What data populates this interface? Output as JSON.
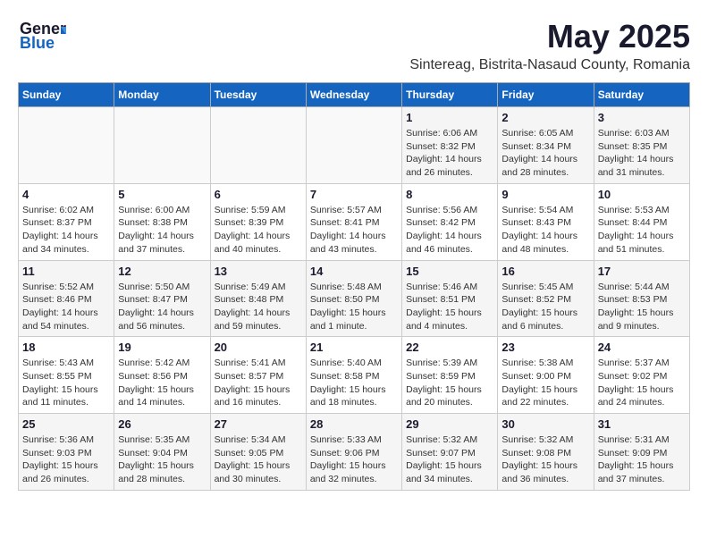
{
  "header": {
    "logo_general": "General",
    "logo_blue": "Blue",
    "title": "May 2025",
    "subtitle": "Sintereag, Bistrita-Nasaud County, Romania"
  },
  "weekdays": [
    "Sunday",
    "Monday",
    "Tuesday",
    "Wednesday",
    "Thursday",
    "Friday",
    "Saturday"
  ],
  "weeks": [
    [
      {
        "day": "",
        "info": ""
      },
      {
        "day": "",
        "info": ""
      },
      {
        "day": "",
        "info": ""
      },
      {
        "day": "",
        "info": ""
      },
      {
        "day": "1",
        "info": "Sunrise: 6:06 AM\nSunset: 8:32 PM\nDaylight: 14 hours\nand 26 minutes."
      },
      {
        "day": "2",
        "info": "Sunrise: 6:05 AM\nSunset: 8:34 PM\nDaylight: 14 hours\nand 28 minutes."
      },
      {
        "day": "3",
        "info": "Sunrise: 6:03 AM\nSunset: 8:35 PM\nDaylight: 14 hours\nand 31 minutes."
      }
    ],
    [
      {
        "day": "4",
        "info": "Sunrise: 6:02 AM\nSunset: 8:37 PM\nDaylight: 14 hours\nand 34 minutes."
      },
      {
        "day": "5",
        "info": "Sunrise: 6:00 AM\nSunset: 8:38 PM\nDaylight: 14 hours\nand 37 minutes."
      },
      {
        "day": "6",
        "info": "Sunrise: 5:59 AM\nSunset: 8:39 PM\nDaylight: 14 hours\nand 40 minutes."
      },
      {
        "day": "7",
        "info": "Sunrise: 5:57 AM\nSunset: 8:41 PM\nDaylight: 14 hours\nand 43 minutes."
      },
      {
        "day": "8",
        "info": "Sunrise: 5:56 AM\nSunset: 8:42 PM\nDaylight: 14 hours\nand 46 minutes."
      },
      {
        "day": "9",
        "info": "Sunrise: 5:54 AM\nSunset: 8:43 PM\nDaylight: 14 hours\nand 48 minutes."
      },
      {
        "day": "10",
        "info": "Sunrise: 5:53 AM\nSunset: 8:44 PM\nDaylight: 14 hours\nand 51 minutes."
      }
    ],
    [
      {
        "day": "11",
        "info": "Sunrise: 5:52 AM\nSunset: 8:46 PM\nDaylight: 14 hours\nand 54 minutes."
      },
      {
        "day": "12",
        "info": "Sunrise: 5:50 AM\nSunset: 8:47 PM\nDaylight: 14 hours\nand 56 minutes."
      },
      {
        "day": "13",
        "info": "Sunrise: 5:49 AM\nSunset: 8:48 PM\nDaylight: 14 hours\nand 59 minutes."
      },
      {
        "day": "14",
        "info": "Sunrise: 5:48 AM\nSunset: 8:50 PM\nDaylight: 15 hours\nand 1 minute."
      },
      {
        "day": "15",
        "info": "Sunrise: 5:46 AM\nSunset: 8:51 PM\nDaylight: 15 hours\nand 4 minutes."
      },
      {
        "day": "16",
        "info": "Sunrise: 5:45 AM\nSunset: 8:52 PM\nDaylight: 15 hours\nand 6 minutes."
      },
      {
        "day": "17",
        "info": "Sunrise: 5:44 AM\nSunset: 8:53 PM\nDaylight: 15 hours\nand 9 minutes."
      }
    ],
    [
      {
        "day": "18",
        "info": "Sunrise: 5:43 AM\nSunset: 8:55 PM\nDaylight: 15 hours\nand 11 minutes."
      },
      {
        "day": "19",
        "info": "Sunrise: 5:42 AM\nSunset: 8:56 PM\nDaylight: 15 hours\nand 14 minutes."
      },
      {
        "day": "20",
        "info": "Sunrise: 5:41 AM\nSunset: 8:57 PM\nDaylight: 15 hours\nand 16 minutes."
      },
      {
        "day": "21",
        "info": "Sunrise: 5:40 AM\nSunset: 8:58 PM\nDaylight: 15 hours\nand 18 minutes."
      },
      {
        "day": "22",
        "info": "Sunrise: 5:39 AM\nSunset: 8:59 PM\nDaylight: 15 hours\nand 20 minutes."
      },
      {
        "day": "23",
        "info": "Sunrise: 5:38 AM\nSunset: 9:00 PM\nDaylight: 15 hours\nand 22 minutes."
      },
      {
        "day": "24",
        "info": "Sunrise: 5:37 AM\nSunset: 9:02 PM\nDaylight: 15 hours\nand 24 minutes."
      }
    ],
    [
      {
        "day": "25",
        "info": "Sunrise: 5:36 AM\nSunset: 9:03 PM\nDaylight: 15 hours\nand 26 minutes."
      },
      {
        "day": "26",
        "info": "Sunrise: 5:35 AM\nSunset: 9:04 PM\nDaylight: 15 hours\nand 28 minutes."
      },
      {
        "day": "27",
        "info": "Sunrise: 5:34 AM\nSunset: 9:05 PM\nDaylight: 15 hours\nand 30 minutes."
      },
      {
        "day": "28",
        "info": "Sunrise: 5:33 AM\nSunset: 9:06 PM\nDaylight: 15 hours\nand 32 minutes."
      },
      {
        "day": "29",
        "info": "Sunrise: 5:32 AM\nSunset: 9:07 PM\nDaylight: 15 hours\nand 34 minutes."
      },
      {
        "day": "30",
        "info": "Sunrise: 5:32 AM\nSunset: 9:08 PM\nDaylight: 15 hours\nand 36 minutes."
      },
      {
        "day": "31",
        "info": "Sunrise: 5:31 AM\nSunset: 9:09 PM\nDaylight: 15 hours\nand 37 minutes."
      }
    ]
  ]
}
